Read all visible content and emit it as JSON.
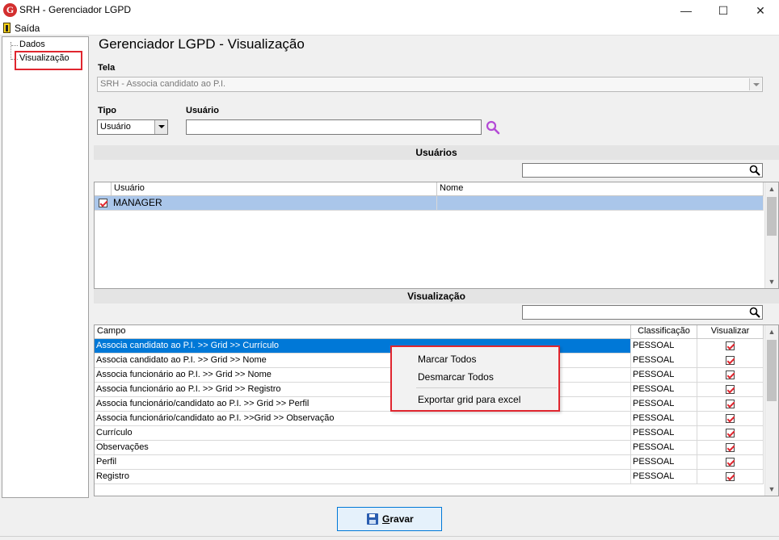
{
  "window": {
    "logo_letter": "G",
    "title": "SRH - Gerenciador LGPD",
    "minimize_glyph": "—",
    "maximize_glyph": "☐",
    "close_glyph": "✕"
  },
  "menu": {
    "exit_label": "Saída"
  },
  "tree": {
    "items": [
      {
        "label": "Dados"
      },
      {
        "label": "Visualização"
      }
    ]
  },
  "page": {
    "title": "Gerenciador LGPD - Visualização"
  },
  "tela": {
    "label": "Tela",
    "value": "SRH - Associa candidato ao P.I."
  },
  "tipo": {
    "label": "Tipo",
    "value": "Usuário"
  },
  "usuario_field": {
    "label": "Usuário",
    "value": ""
  },
  "usuarios_section": {
    "title": "Usuários",
    "columns": [
      "Usuário",
      "Nome"
    ],
    "rows": [
      {
        "usuario": "MANAGER",
        "nome": "",
        "checked": true
      }
    ]
  },
  "visualizacao_section": {
    "title": "Visualização",
    "columns": [
      "Campo",
      "Classificação",
      "Visualizar"
    ],
    "rows": [
      {
        "campo": "Associa candidato ao P.I. >> Grid >> Currículo",
        "classificacao": "PESSOAL",
        "visualizar": true
      },
      {
        "campo": "Associa candidato ao P.I. >> Grid >> Nome",
        "classificacao": "PESSOAL",
        "visualizar": true
      },
      {
        "campo": "Associa funcionário ao P.I. >> Grid >> Nome",
        "classificacao": "PESSOAL",
        "visualizar": true
      },
      {
        "campo": "Associa funcionário ao P.I. >> Grid >> Registro",
        "classificacao": "PESSOAL",
        "visualizar": true
      },
      {
        "campo": "Associa funcionário/candidato ao P.I. >> Grid >> Perfil",
        "classificacao": "PESSOAL",
        "visualizar": true
      },
      {
        "campo": "Associa funcionário/candidato ao P.I. >>Grid >> Observação",
        "classificacao": "PESSOAL",
        "visualizar": true
      },
      {
        "campo": "Currículo",
        "classificacao": "PESSOAL",
        "visualizar": true
      },
      {
        "campo": "Observações",
        "classificacao": "PESSOAL",
        "visualizar": true
      },
      {
        "campo": "Perfil",
        "classificacao": "PESSOAL",
        "visualizar": true
      },
      {
        "campo": "Registro",
        "classificacao": "PESSOAL",
        "visualizar": true
      }
    ]
  },
  "context_menu": {
    "items": [
      {
        "label": "Marcar Todos"
      },
      {
        "label": "Desmarcar Todos"
      },
      {
        "label": "Exportar grid para excel"
      }
    ]
  },
  "footer": {
    "save_label_first": "G",
    "save_label_rest": "ravar"
  },
  "icons": {
    "search": "magnifier-icon",
    "save": "floppy-disk-icon",
    "exit": "exit-door-icon"
  },
  "colors": {
    "accent": "#0078d7",
    "highlight_border": "#e0262f",
    "search_icon_purple": "#b44ad6"
  }
}
